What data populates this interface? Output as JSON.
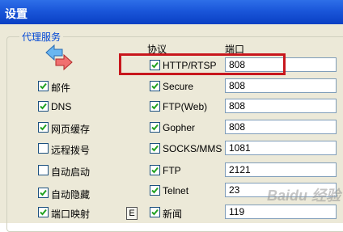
{
  "window": {
    "title": "设置"
  },
  "group": {
    "title": "代理服务"
  },
  "headers": {
    "protocol": "协议",
    "port": "端口"
  },
  "left_items": [
    {
      "label": "邮件",
      "checked": true
    },
    {
      "label": "DNS",
      "checked": true
    },
    {
      "label": "网页缓存",
      "checked": true
    },
    {
      "label": "远程拨号",
      "checked": false
    },
    {
      "label": "自动启动",
      "checked": false
    },
    {
      "label": "自动隐藏",
      "checked": true
    },
    {
      "label": "端口映射",
      "checked": true
    }
  ],
  "port_mapping_button": "E",
  "protocols": [
    {
      "label": "HTTP/RTSP",
      "checked": true,
      "port": "808",
      "highlighted": true
    },
    {
      "label": "Secure",
      "checked": true,
      "port": "808"
    },
    {
      "label": "FTP(Web)",
      "checked": true,
      "port": "808"
    },
    {
      "label": "Gopher",
      "checked": true,
      "port": "808"
    },
    {
      "label": "SOCKS/MMS",
      "checked": true,
      "port": "1081"
    },
    {
      "label": "FTP",
      "checked": true,
      "port": "2121"
    },
    {
      "label": "Telnet",
      "checked": true,
      "port": "23"
    },
    {
      "label": "新闻",
      "checked": true,
      "port": "119"
    }
  ],
  "colors": {
    "highlight_box": "#c8171d",
    "group_title": "#0046d5",
    "check": "#21a121"
  },
  "watermark": "Baidu 经验"
}
